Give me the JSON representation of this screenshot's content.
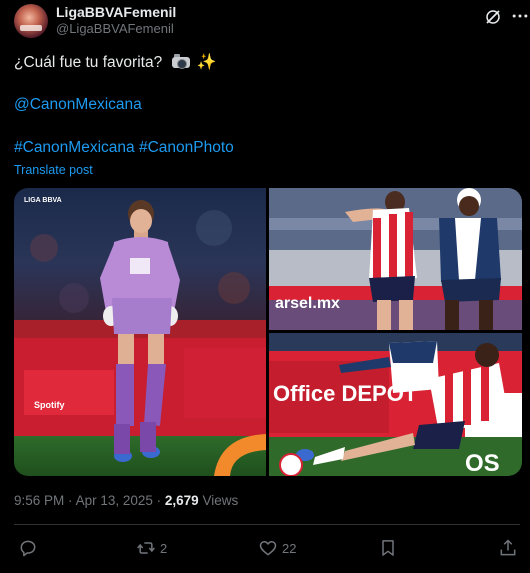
{
  "author": {
    "display_name": "LigaBBVAFemenil",
    "handle": "@LigaBBVAFemenil"
  },
  "tweet": {
    "line1": "¿Cuál fue tu favorita?",
    "mention": "@CanonMexicana",
    "hashtag1": "#CanonMexicana",
    "hashtag2": "#CanonPhoto",
    "translate_label": "Translate post"
  },
  "media": {
    "photo1_watermark": "LIGA BBVA",
    "photo1_sponsor": "Spotify",
    "photo2_board": "arsel.mx",
    "photo3_board": "Office DEPOT",
    "photo3_board_right": "OS"
  },
  "meta": {
    "time": "9:56 PM",
    "separator": "·",
    "date": "Apr 13, 2025",
    "views_count": "2,679",
    "views_label": "Views"
  },
  "actions": {
    "reply_count": "",
    "repost_count": "2",
    "like_count": "22"
  },
  "colors": {
    "background": "#000000",
    "text": "#e7e9ea",
    "secondary_text": "#71767b",
    "link": "#1d9bf0"
  }
}
